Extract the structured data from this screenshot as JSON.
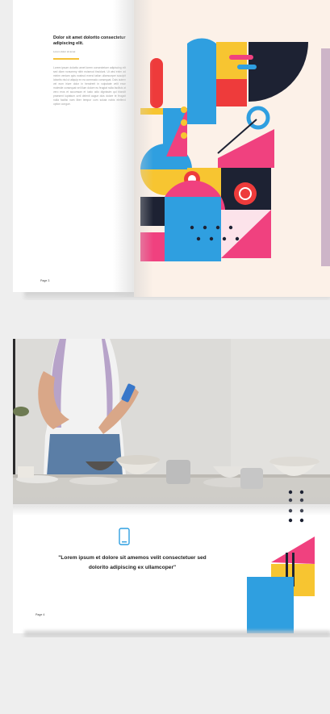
{
  "spread_1": {
    "heading": "Dolor sit amet dolorito consectetur adipiscing elit.",
    "subheading": "Lorem dolor sit amet",
    "body": "Lorem ipsum dolorito amet lorem consectetuer adipiscing elit sed diam nonummy nibh euismod tincidunt. Ut wisi enim ad minim veniam quis nostrud exerci tation ullamcorper suscipit lobortis nisl ut aliquip ex ea commodo consequat. Duis autem vel eum iriure dolor in hendrerit in vulputate velit esse molestie consequat vel illum dolore eu feugiat nulla facilisis at vero eros et accumsan et iusto odio dignissim qui blandit praesent luptatum zzril delenit augue duis dolore te feugait nulla facilisi nam liber tempor cum soluta nobis eleifend option congue.",
    "folio": "Page 3"
  },
  "spread_2": {
    "quote": "\"Lorem ipsum et dolore sit amemos velit consectetuer sed dolorito adipiscing ex ullamcoper\"",
    "folio": "Page 4"
  },
  "colors": {
    "blue": "#2f9fe0",
    "pink": "#f0417f",
    "yellow": "#f7c531",
    "red": "#ee3b3b",
    "navy": "#1d2233",
    "paper": "#fcf1e8"
  },
  "icons": [
    "phone-icon"
  ]
}
